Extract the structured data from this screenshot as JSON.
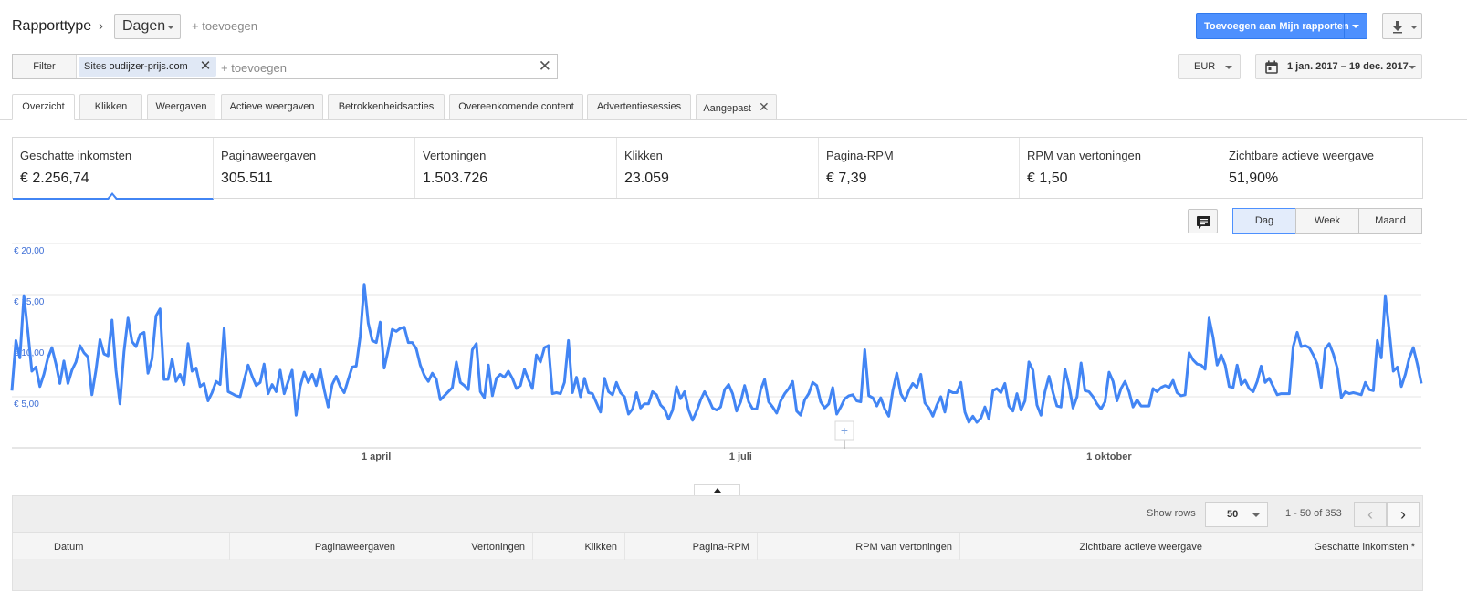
{
  "header": {
    "report_type_label": "Rapporttype",
    "group_by": "Dagen",
    "add_dimension": "+ toevoegen",
    "add_report_button": "Toevoegen aan Mijn rapporten"
  },
  "filter": {
    "label": "Filter",
    "chip_key": "Sites",
    "chip_value": "oudijzer-prijs.com",
    "add_placeholder": "+ toevoegen"
  },
  "currency": "EUR",
  "date_range": "1 jan. 2017 – 19 dec. 2017",
  "tabs": [
    {
      "label": "Overzicht"
    },
    {
      "label": "Klikken"
    },
    {
      "label": "Weergaven"
    },
    {
      "label": "Actieve weergaven"
    },
    {
      "label": "Betrokkenheidsacties"
    },
    {
      "label": "Overeenkomende content"
    },
    {
      "label": "Advertentiesessies"
    },
    {
      "label": "Aangepast"
    }
  ],
  "scorecards": [
    {
      "name": "Geschatte inkomsten",
      "value": "€ 2.256,74"
    },
    {
      "name": "Paginaweergaven",
      "value": "305.511"
    },
    {
      "name": "Vertoningen",
      "value": "1.503.726"
    },
    {
      "name": "Klikken",
      "value": "23.059"
    },
    {
      "name": "Pagina-RPM",
      "value": "€ 7,39"
    },
    {
      "name": "RPM van vertoningen",
      "value": "€ 1,50"
    },
    {
      "name": "Zichtbare actieve weergave",
      "value": "51,90%"
    }
  ],
  "granularity": {
    "day": "Dag",
    "week": "Week",
    "month": "Maand",
    "selected": "Dag"
  },
  "chart_data": {
    "type": "line",
    "series_color": "#4285f4",
    "y_ticks": [
      "€ 5,00",
      "€ 10,00",
      "€ 15,00",
      "€ 20,00"
    ],
    "y_tick_values": [
      5,
      10,
      15,
      20
    ],
    "ylim": [
      0,
      20
    ],
    "x_tick_labels": [
      "1 april",
      "1 juli",
      "1 oktober"
    ],
    "x_tick_days": [
      91,
      182,
      274
    ],
    "x_start_label": "1 jan. 2017",
    "num_days": 353,
    "values": [
      5.6,
      10.5,
      8.8,
      14.9,
      11.4,
      7.5,
      7.9,
      6.0,
      7.2,
      8.8,
      9.8,
      8.2,
      6.3,
      8.5,
      6.3,
      7.6,
      8.4,
      10.0,
      9.3,
      8.9,
      5.2,
      7.6,
      10.6,
      9.2,
      9.0,
      12.5,
      7.6,
      4.3,
      9.4,
      12.7,
      10.4,
      9.9,
      11.1,
      11.3,
      7.3,
      8.7,
      12.9,
      13.6,
      6.7,
      6.7,
      8.7,
      6.5,
      7.2,
      6.2,
      10.2,
      7.5,
      7.8,
      6.0,
      6.3,
      4.6,
      5.4,
      6.5,
      6.2,
      11.7,
      5.5,
      5.3,
      5.1,
      5.0,
      6.6,
      8.1,
      7.0,
      6.1,
      6.4,
      8.2,
      5.3,
      6.2,
      5.5,
      7.6,
      5.3,
      6.5,
      7.6,
      3.2,
      6.0,
      7.4,
      6.4,
      7.2,
      6.1,
      7.7,
      5.7,
      4.0,
      6.2,
      7.0,
      6.0,
      5.4,
      6.7,
      7.9,
      8.0,
      10.9,
      16.0,
      12.2,
      10.5,
      10.3,
      12.3,
      7.8,
      9.6,
      11.6,
      11.4,
      11.7,
      11.8,
      10.3,
      10.3,
      9.7,
      8.1,
      7.1,
      6.5,
      7.3,
      6.7,
      4.7,
      5.1,
      5.5,
      5.9,
      8.4,
      6.4,
      6.1,
      5.7,
      9.6,
      10.2,
      5.5,
      4.9,
      8.1,
      5.1,
      6.8,
      7.2,
      6.9,
      7.5,
      6.8,
      5.8,
      6.1,
      7.7,
      6.7,
      5.8,
      9.1,
      8.4,
      9.8,
      10.0,
      5.3,
      5.4,
      5.3,
      6.4,
      10.5,
      5.4,
      6.9,
      5.0,
      6.8,
      5.4,
      5.3,
      4.4,
      3.5,
      6.8,
      5.5,
      5.2,
      6.4,
      5.4,
      5.0,
      3.3,
      3.8,
      5.4,
      3.9,
      4.3,
      4.3,
      5.5,
      5.2,
      4.2,
      3.8,
      2.8,
      3.7,
      6.0,
      4.8,
      5.5,
      3.7,
      2.7,
      3.6,
      4.7,
      5.5,
      4.8,
      3.9,
      3.7,
      4.0,
      5.7,
      6.2,
      5.3,
      3.6,
      4.5,
      6.1,
      4.5,
      3.8,
      3.8,
      5.7,
      6.7,
      4.5,
      4.0,
      3.4,
      4.6,
      5.3,
      5.8,
      6.5,
      3.6,
      3.2,
      4.7,
      5.3,
      6.4,
      6.1,
      4.5,
      3.9,
      4.3,
      5.9,
      3.3,
      4.0,
      4.8,
      5.1,
      5.2,
      4.6,
      4.5,
      9.6,
      5.1,
      4.9,
      4.1,
      4.9,
      3.8,
      3.1,
      5.6,
      7.3,
      5.3,
      4.6,
      5.6,
      6.3,
      5.9,
      7.2,
      4.4,
      3.9,
      3.1,
      4.2,
      5.0,
      3.5,
      5.6,
      5.4,
      5.4,
      6.4,
      3.5,
      2.5,
      3.1,
      2.5,
      2.9,
      4.0,
      2.8,
      5.6,
      5.8,
      5.4,
      6.3,
      4.1,
      3.6,
      5.3,
      3.7,
      4.6,
      8.4,
      7.6,
      4.2,
      3.2,
      5.5,
      7.0,
      5.4,
      4.1,
      4.0,
      7.7,
      6.1,
      3.9,
      5.0,
      8.3,
      5.6,
      5.5,
      5.0,
      4.3,
      3.8,
      4.5,
      7.4,
      6.5,
      4.6,
      5.8,
      6.5,
      5.5,
      4.0,
      4.7,
      4.1,
      4.1,
      4.1,
      5.8,
      5.5,
      5.9,
      6.1,
      5.9,
      6.6,
      5.4,
      5.1,
      5.2,
      9.3,
      8.6,
      8.2,
      8.1,
      7.7,
      12.7,
      10.8,
      8.1,
      9.1,
      8.1,
      6.0,
      5.9,
      8.1,
      6.2,
      6.6,
      5.8,
      5.5,
      6.5,
      8.0,
      6.4,
      6.8,
      6.0,
      5.2,
      5.3,
      5.3,
      5.3,
      9.9,
      11.3,
      9.9,
      10.0,
      9.8,
      9.1,
      8.2,
      5.9,
      9.7,
      10.2,
      9.2,
      7.8,
      4.9,
      5.5,
      5.3,
      5.4,
      5.3,
      5.2,
      6.4,
      5.7
    ]
  },
  "table": {
    "show_rows_label": "Show rows",
    "rows_value": "50",
    "range_label": "1 - 50 of 353",
    "columns": [
      "Datum",
      "Paginaweergaven",
      "Vertoningen",
      "Klikken",
      "Pagina-RPM",
      "RPM van vertoningen",
      "Zichtbare actieve weergave",
      "Geschatte inkomsten *"
    ]
  }
}
